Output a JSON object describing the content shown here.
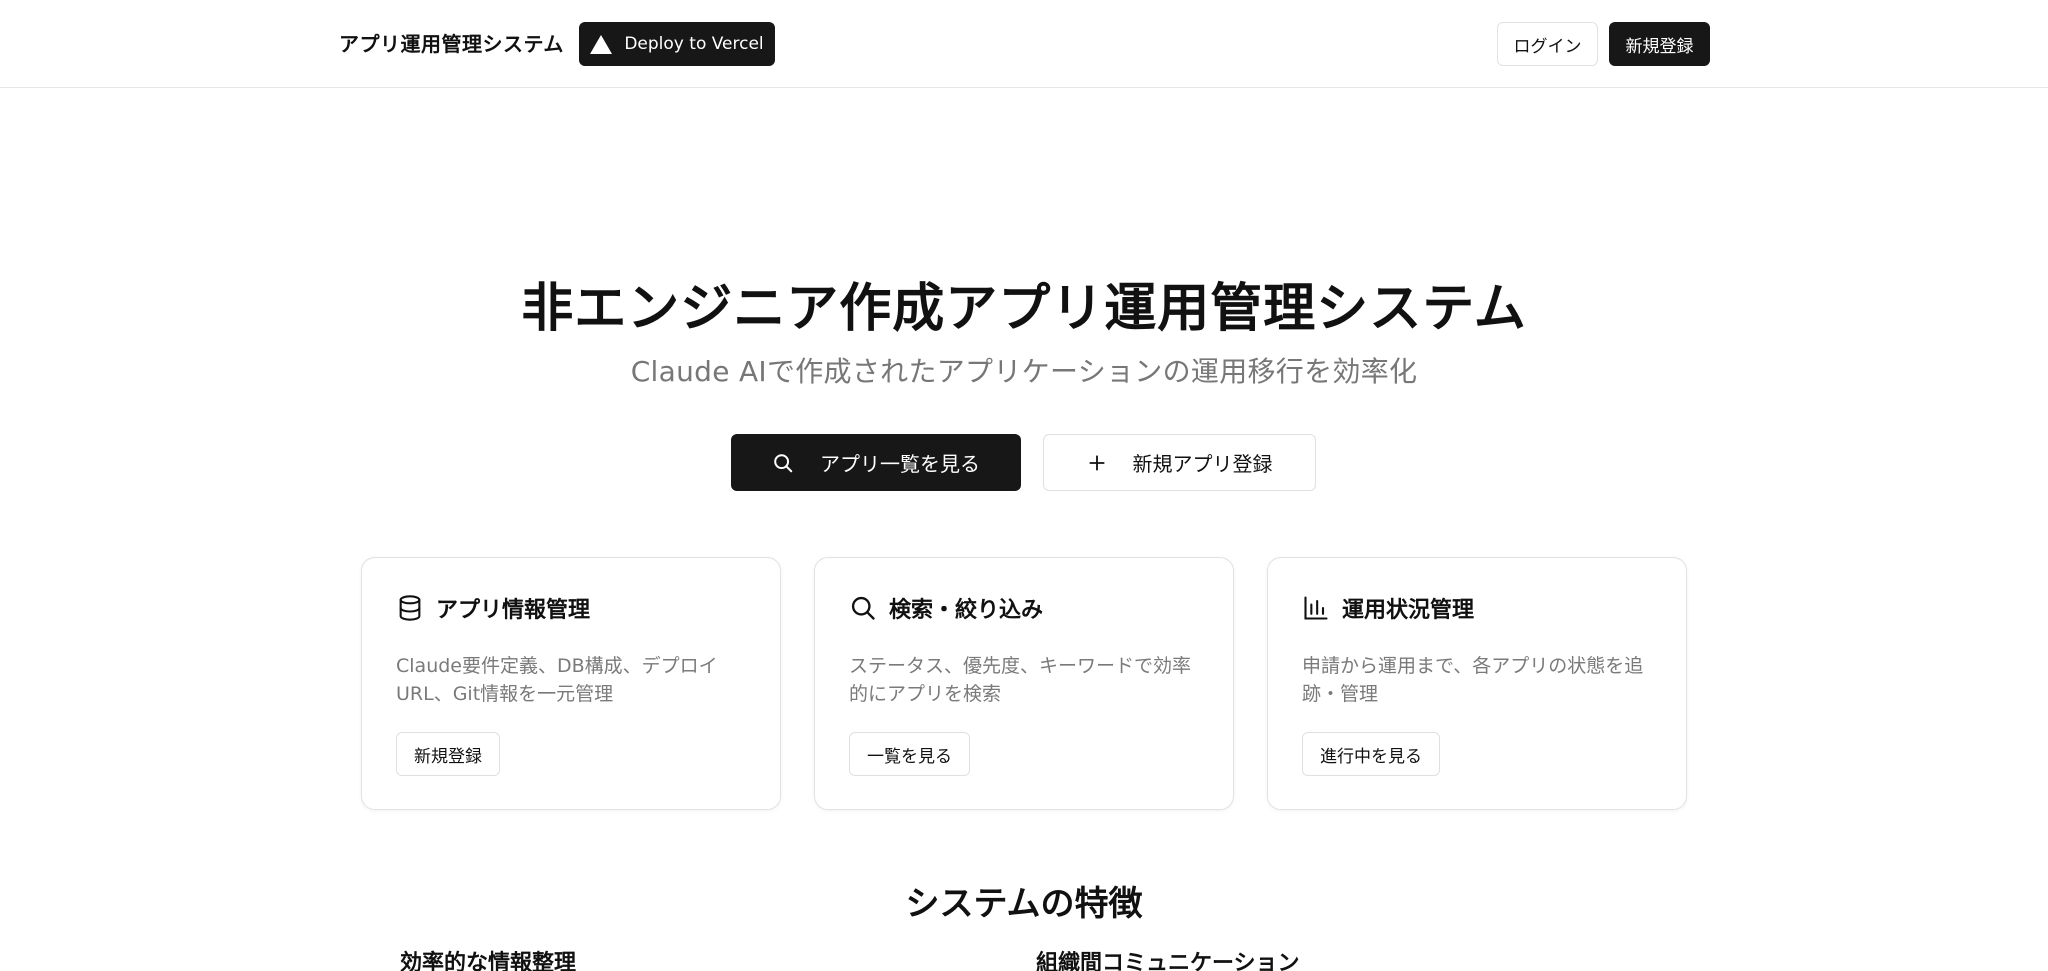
{
  "header": {
    "brand": "アプリ運用管理システム",
    "deploy_label": "Deploy to Vercel",
    "login_label": "ログイン",
    "signup_label": "新規登録"
  },
  "hero": {
    "title": "非エンジニア作成アプリ運用管理システム",
    "subtitle": "Claude AIで作成されたアプリケーションの運用移行を効率化",
    "primary_cta": "アプリ一覧を見る",
    "secondary_cta": "新規アプリ登録"
  },
  "cards": [
    {
      "icon": "database-icon",
      "title": "アプリ情報管理",
      "description": "Claude要件定義、DB構成、デプロイURL、Git情報を一元管理",
      "button": "新規登録"
    },
    {
      "icon": "search-icon",
      "title": "検索・絞り込み",
      "description": "ステータス、優先度、キーワードで効率的にアプリを検索",
      "button": "一覧を見る"
    },
    {
      "icon": "bar-chart-icon",
      "title": "運用状況管理",
      "description": "申請から運用まで、各アプリの状態を追跡・管理",
      "button": "進行中を見る"
    }
  ],
  "features": {
    "title": "システムの特徴",
    "items": [
      {
        "title": "効率的な情報整理"
      },
      {
        "title": "組織間コミュニケーション"
      }
    ]
  },
  "colors": {
    "primary": "#171717",
    "muted_text": "#777777",
    "border": "#e2e2e2"
  }
}
